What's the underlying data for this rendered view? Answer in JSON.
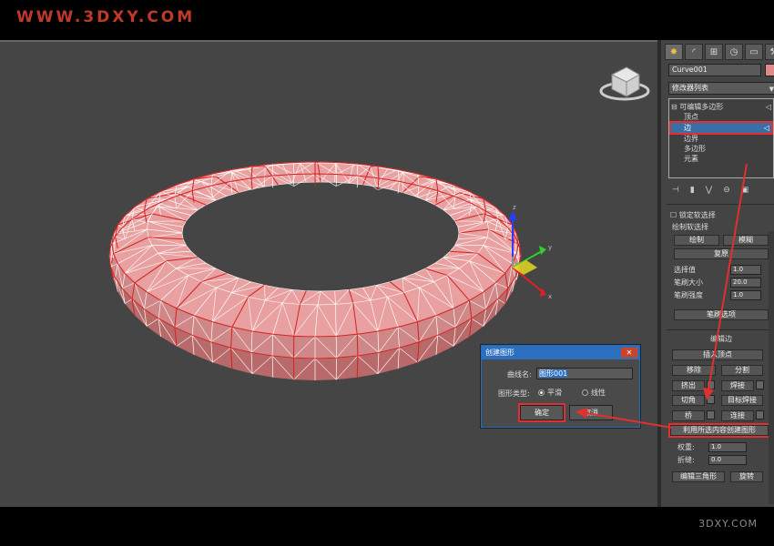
{
  "watermarks": {
    "top": "WWW.3DXY.COM",
    "bottom": "3DXY.COM"
  },
  "colors": {
    "accent_red": "#e03030",
    "mesh_pink": "#e8a0a0",
    "wire_white": "#ffffff",
    "edge_red": "#d42020",
    "dialog_blue": "#2d6fbf"
  },
  "panel": {
    "tabs": [
      "create-icon",
      "modify-icon",
      "hierarchy-icon",
      "motion-icon",
      "display-icon",
      "utilities-icon"
    ],
    "object_name": "Curve001",
    "modifier_list": "修改器列表",
    "stack": {
      "root": "可编辑多边形",
      "items": [
        "顶点",
        "边",
        "边界",
        "多边形",
        "元素"
      ],
      "selected": "边"
    },
    "soft": {
      "lock": "锁定软选择",
      "paint_title": "绘制软选择",
      "paint": "绘制",
      "blur": "模糊",
      "revert": "复原",
      "sel_value": "选择值",
      "sel_value_v": "1.0",
      "brush_size": "笔刷大小",
      "brush_size_v": "20.0",
      "brush_strength": "笔刷强度",
      "brush_strength_v": "1.0",
      "brush_options": "笔刷选项"
    },
    "edit_edges": {
      "title": "编辑边",
      "insert_vertex": "插入顶点",
      "remove": "移除",
      "split": "分割",
      "extrude": "挤出",
      "weld": "焊接",
      "chamfer": "切角",
      "target_weld": "目标焊接",
      "bridge": "桥",
      "connect": "连接",
      "create_shape": "利用所选内容创建图形",
      "weight": "权重:",
      "weight_v": "1.0",
      "crease": "折缝:",
      "crease_v": "0.0",
      "edit_tri": "编辑三角形",
      "turn": "旋转"
    }
  },
  "dialog": {
    "title": "创建图形",
    "close": "✕",
    "name_label": "曲线名:",
    "name_value": "图形001",
    "type_label": "图形类型:",
    "smooth": "平滑",
    "linear": "线性",
    "ok": "确定",
    "cancel": "取消"
  },
  "axis": {
    "x": "x",
    "y": "y",
    "z": "z"
  }
}
